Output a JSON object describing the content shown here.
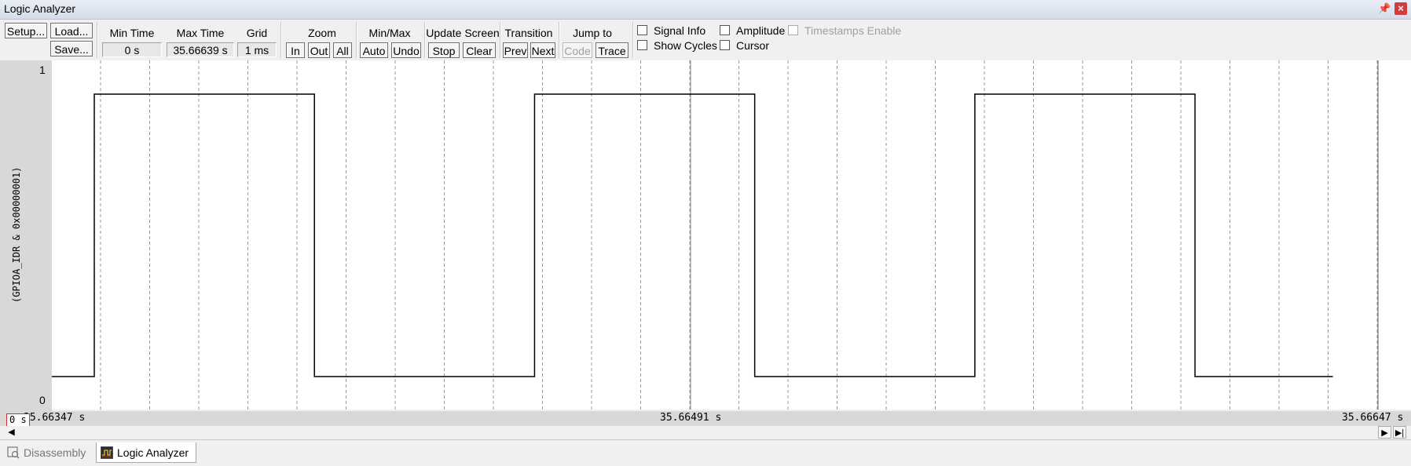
{
  "window": {
    "title": "Logic Analyzer"
  },
  "toolbar": {
    "setup": "Setup...",
    "load": "Load...",
    "save": "Save...",
    "min_time_label": "Min Time",
    "min_time_value": "0 s",
    "max_time_label": "Max Time",
    "max_time_value": "35.66639 s",
    "grid_label": "Grid",
    "grid_value": "1 ms",
    "zoom_label": "Zoom",
    "zoom_in": "In",
    "zoom_out": "Out",
    "zoom_all": "All",
    "minmax_label": "Min/Max",
    "minmax_auto": "Auto",
    "minmax_undo": "Undo",
    "update_label": "Update Screen",
    "update_stop": "Stop",
    "update_clear": "Clear",
    "transition_label": "Transition",
    "transition_prev": "Prev",
    "transition_next": "Next",
    "jump_label": "Jump to",
    "jump_code": "Code",
    "jump_trace": "Trace",
    "signal_info": "Signal Info",
    "show_cycles": "Show Cycles",
    "amplitude": "Amplitude",
    "cursor": "Cursor",
    "timestamps": "Timestamps Enable"
  },
  "plot": {
    "signal_name": "(GPIOA_IDR & 0x00000001)",
    "y_max": "1",
    "y_min": "0",
    "transitions": [
      0.032,
      0.198,
      0.364,
      0.53,
      0.696,
      0.862
    ],
    "end": 0.966
  },
  "timebar": {
    "start_box": "0 s",
    "start": "35.66347 s",
    "mid": "35.66491 s",
    "end": "35.66647 s"
  },
  "tabs": [
    {
      "label": "Disassembly",
      "active": false
    },
    {
      "label": "Logic Analyzer",
      "active": true
    }
  ],
  "colors": {
    "signal": "#000000",
    "grid": "#9a9a9a",
    "cursor": "#808080"
  }
}
